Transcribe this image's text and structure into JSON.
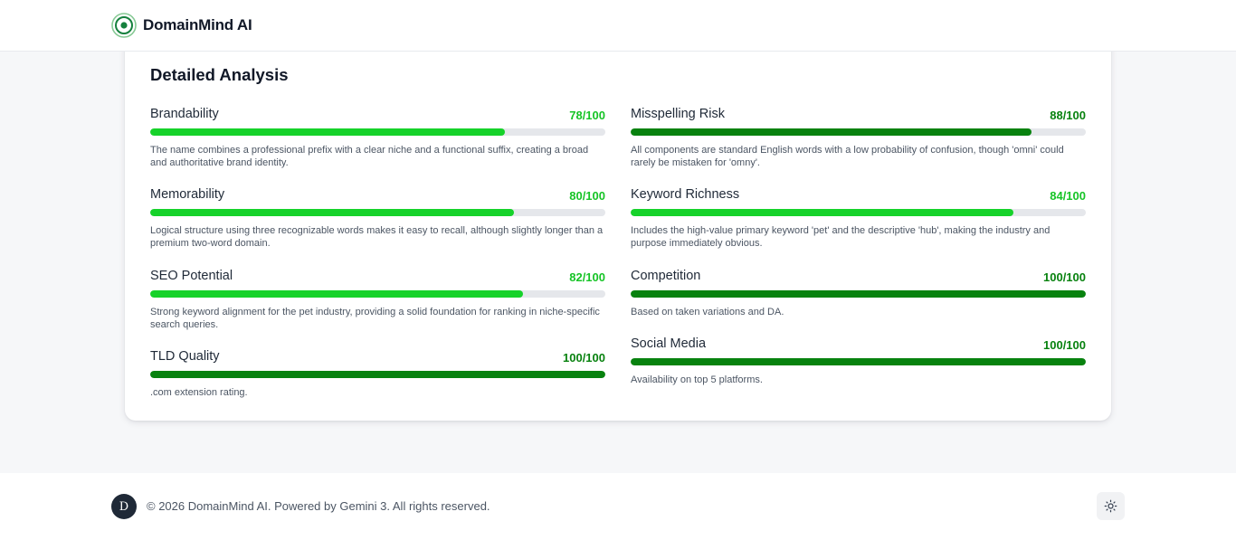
{
  "header": {
    "brand_name": "DomainMind AI",
    "logo_icon": "target-icon",
    "accent": "#16a34a"
  },
  "analysis": {
    "title": "Detailed Analysis",
    "metrics": [
      {
        "label": "Brandability",
        "score_text": "78/100",
        "value": 78,
        "tone": "bright",
        "description": "The name combines a professional prefix with a clear niche and a functional suffix, creating a broad and authoritative brand identity."
      },
      {
        "label": "Misspelling Risk",
        "score_text": "88/100",
        "value": 88,
        "tone": "dark",
        "description": "All components are standard English words with a low probability of confusion, though 'omni' could rarely be mistaken for 'omny'."
      },
      {
        "label": "Memorability",
        "score_text": "80/100",
        "value": 80,
        "tone": "bright",
        "description": "Logical structure using three recognizable words makes it easy to recall, although slightly longer than a premium two-word domain."
      },
      {
        "label": "Keyword Richness",
        "score_text": "84/100",
        "value": 84,
        "tone": "bright",
        "description": "Includes the high-value primary keyword 'pet' and the descriptive 'hub', making the industry and purpose immediately obvious."
      },
      {
        "label": "SEO Potential",
        "score_text": "82/100",
        "value": 82,
        "tone": "bright",
        "description": "Strong keyword alignment for the pet industry, providing a solid foundation for ranking in niche-specific search queries."
      },
      {
        "label": "Competition",
        "score_text": "100/100",
        "value": 100,
        "tone": "dark",
        "description": "Based on taken variations and DA."
      },
      {
        "label": "TLD Quality",
        "score_text": "100/100",
        "value": 100,
        "tone": "dark",
        "description": ".com extension rating."
      },
      {
        "label": "Social Media",
        "score_text": "100/100",
        "value": 100,
        "tone": "dark",
        "description": "Availability on top 5 platforms."
      }
    ],
    "colors": {
      "bright": "#16d22a",
      "dark": "#08820f",
      "track": "#e5e7eb"
    }
  },
  "footer": {
    "avatar_letter": "D",
    "copyright": "© 2026 DomainMind AI. Powered by Gemini 3. All rights reserved.",
    "theme_icon": "sun-icon"
  }
}
